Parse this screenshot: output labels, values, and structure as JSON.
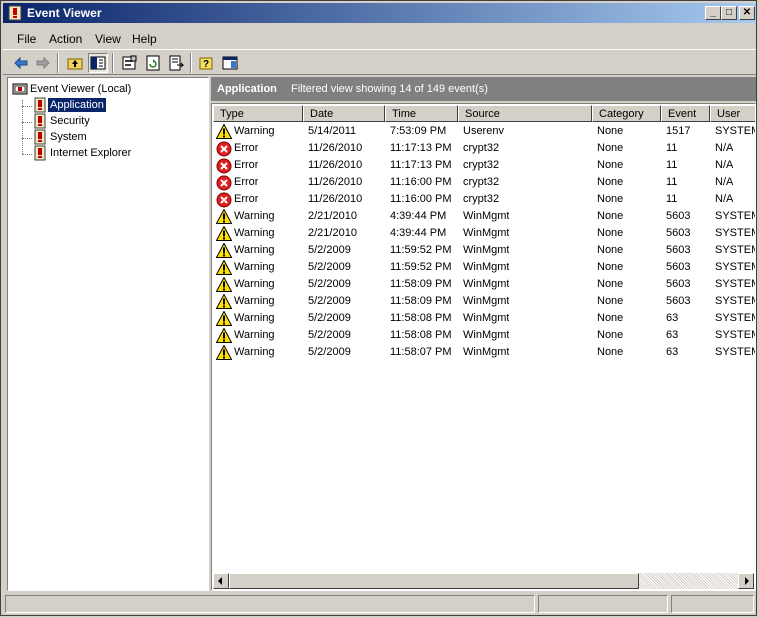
{
  "window": {
    "title": "Event Viewer"
  },
  "title_buttons": {
    "minimize": "_",
    "maximize": "□",
    "close": "✕"
  },
  "menu": {
    "items": [
      "File",
      "Action",
      "View",
      "Help"
    ]
  },
  "toolbar": {
    "buttons": [
      "back-icon",
      "forward-icon",
      "up-folder-icon",
      "show-hide-tree-icon",
      "properties-icon",
      "refresh-icon",
      "export-list-icon",
      "help-icon",
      "description-icon"
    ]
  },
  "tree": {
    "root": "Event Viewer (Local)",
    "children": [
      "Application",
      "Security",
      "System",
      "Internet Explorer"
    ],
    "selected": "Application"
  },
  "pane": {
    "title": "Application",
    "status": "Filtered view showing 14 of 149 event(s)"
  },
  "columns": [
    "Type",
    "Date",
    "Time",
    "Source",
    "Category",
    "Event",
    "User"
  ],
  "rows": [
    {
      "type": "Warning",
      "date": "5/14/2011",
      "time": "7:53:09 PM",
      "source": "Userenv",
      "category": "None",
      "event": "1517",
      "user": "SYSTEM"
    },
    {
      "type": "Error",
      "date": "11/26/2010",
      "time": "11:17:13 PM",
      "source": "crypt32",
      "category": "None",
      "event": "11",
      "user": "N/A"
    },
    {
      "type": "Error",
      "date": "11/26/2010",
      "time": "11:17:13 PM",
      "source": "crypt32",
      "category": "None",
      "event": "11",
      "user": "N/A"
    },
    {
      "type": "Error",
      "date": "11/26/2010",
      "time": "11:16:00 PM",
      "source": "crypt32",
      "category": "None",
      "event": "11",
      "user": "N/A"
    },
    {
      "type": "Error",
      "date": "11/26/2010",
      "time": "11:16:00 PM",
      "source": "crypt32",
      "category": "None",
      "event": "11",
      "user": "N/A"
    },
    {
      "type": "Warning",
      "date": "2/21/2010",
      "time": "4:39:44 PM",
      "source": "WinMgmt",
      "category": "None",
      "event": "5603",
      "user": "SYSTEM"
    },
    {
      "type": "Warning",
      "date": "2/21/2010",
      "time": "4:39:44 PM",
      "source": "WinMgmt",
      "category": "None",
      "event": "5603",
      "user": "SYSTEM"
    },
    {
      "type": "Warning",
      "date": "5/2/2009",
      "time": "11:59:52 PM",
      "source": "WinMgmt",
      "category": "None",
      "event": "5603",
      "user": "SYSTEM"
    },
    {
      "type": "Warning",
      "date": "5/2/2009",
      "time": "11:59:52 PM",
      "source": "WinMgmt",
      "category": "None",
      "event": "5603",
      "user": "SYSTEM"
    },
    {
      "type": "Warning",
      "date": "5/2/2009",
      "time": "11:58:09 PM",
      "source": "WinMgmt",
      "category": "None",
      "event": "5603",
      "user": "SYSTEM"
    },
    {
      "type": "Warning",
      "date": "5/2/2009",
      "time": "11:58:09 PM",
      "source": "WinMgmt",
      "category": "None",
      "event": "5603",
      "user": "SYSTEM"
    },
    {
      "type": "Warning",
      "date": "5/2/2009",
      "time": "11:58:08 PM",
      "source": "WinMgmt",
      "category": "None",
      "event": "63",
      "user": "SYSTEM"
    },
    {
      "type": "Warning",
      "date": "5/2/2009",
      "time": "11:58:08 PM",
      "source": "WinMgmt",
      "category": "None",
      "event": "63",
      "user": "SYSTEM"
    },
    {
      "type": "Warning",
      "date": "5/2/2009",
      "time": "11:58:07 PM",
      "source": "WinMgmt",
      "category": "None",
      "event": "63",
      "user": "SYSTEM"
    }
  ],
  "status_bar": {
    "panels": [
      "",
      "",
      ""
    ]
  },
  "colors": {
    "title_start": "#0a246a",
    "title_end": "#a6caf0",
    "selection": "#0a246a",
    "pane_header": "#808080"
  }
}
